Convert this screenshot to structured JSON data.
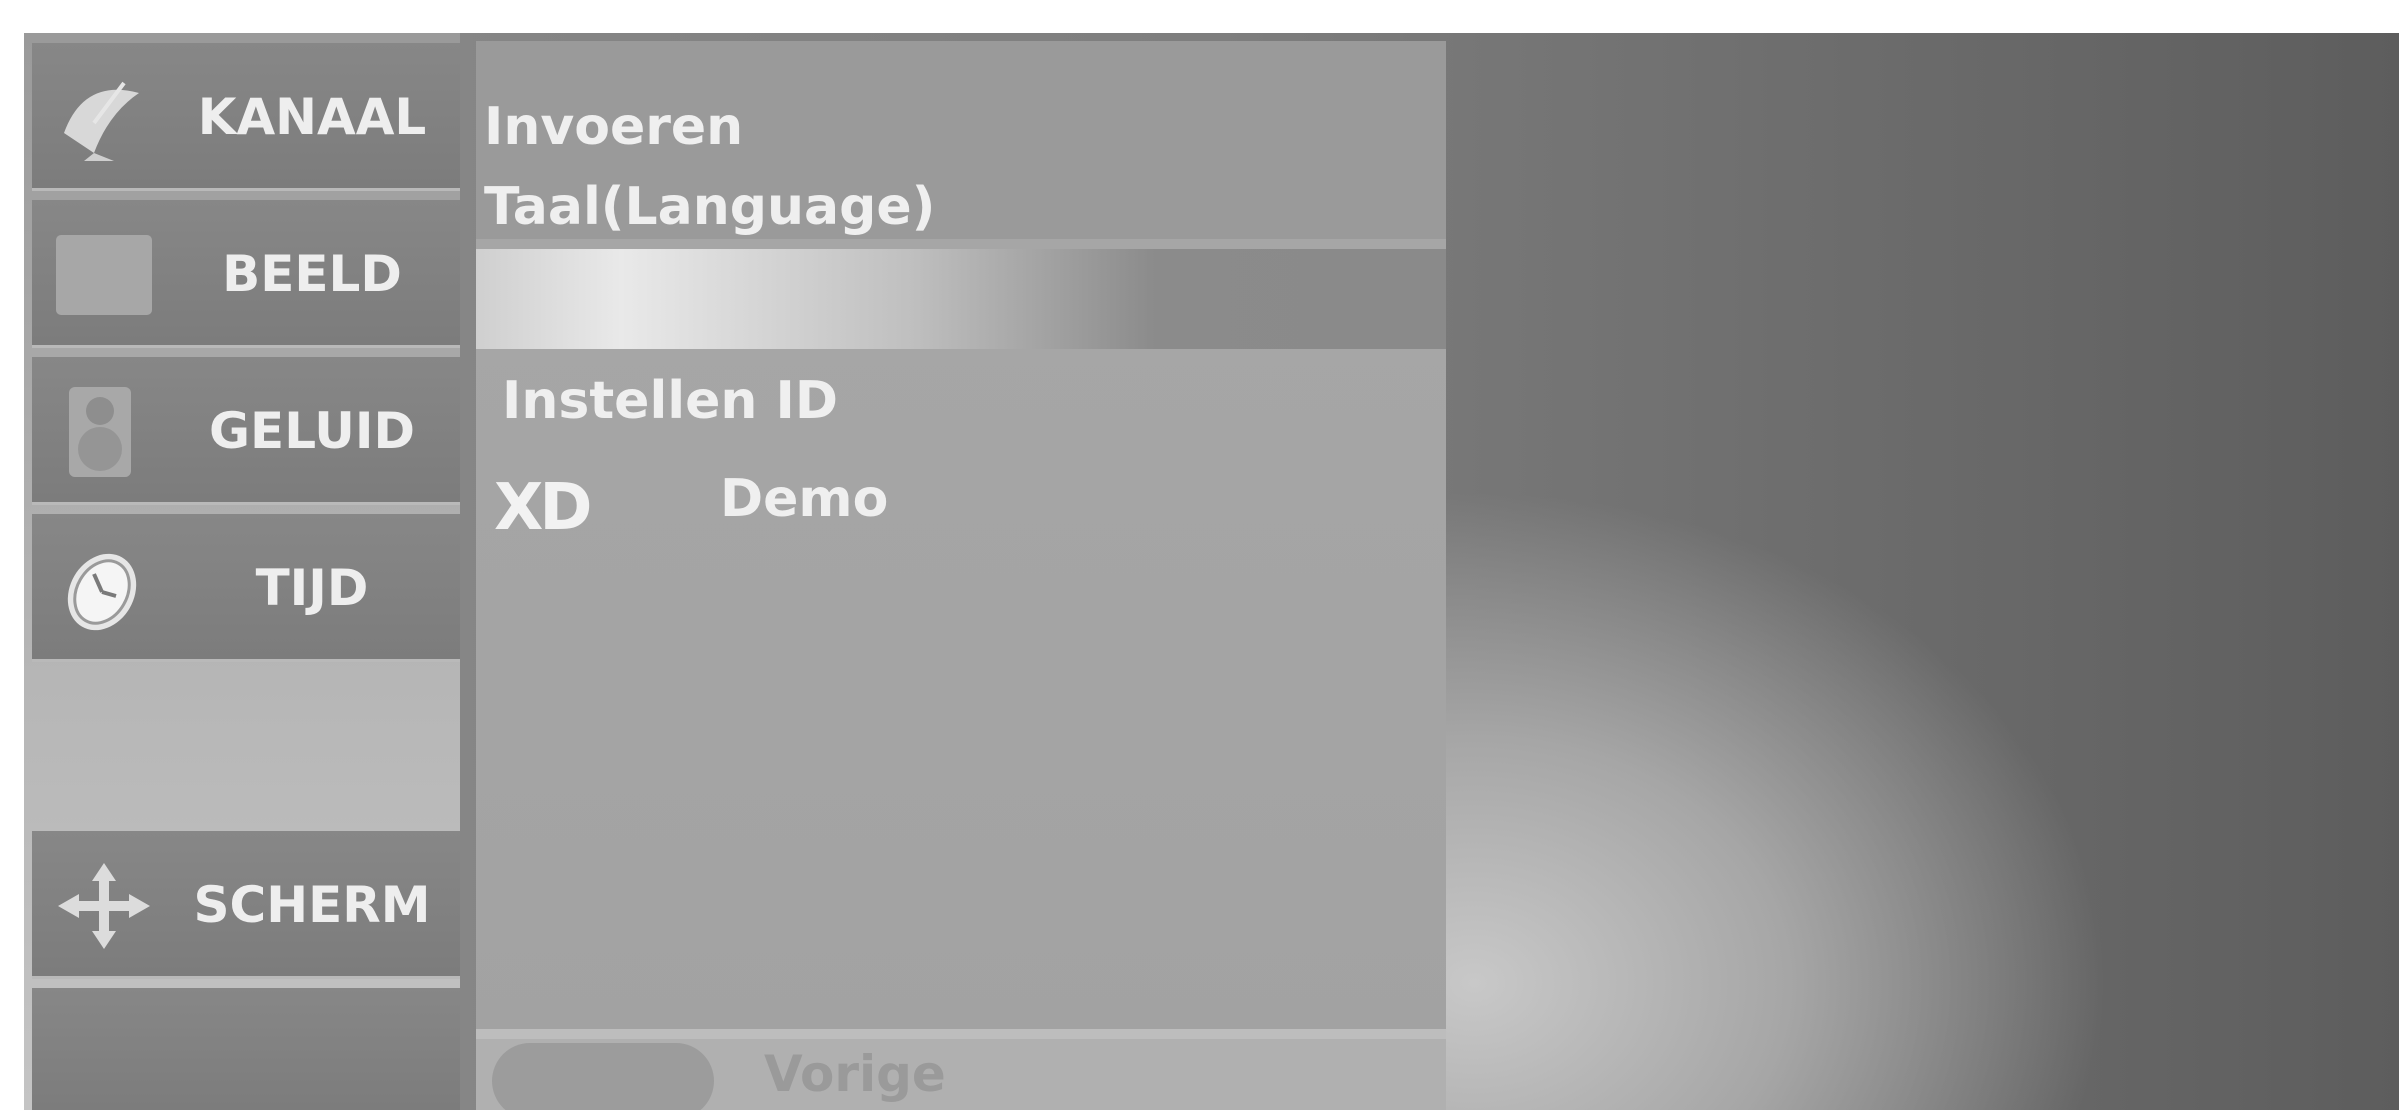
{
  "menu": {
    "items": [
      {
        "label": "KANAAL",
        "icon": "satellite-dish-icon"
      },
      {
        "label": "BEELD",
        "icon": "picture-square-icon"
      },
      {
        "label": "GELUID",
        "icon": "speaker-icon"
      },
      {
        "label": "TIJD",
        "icon": "clock-icon"
      },
      {
        "label": "SCHERM",
        "icon": "move-arrows-icon"
      }
    ]
  },
  "submenu": {
    "items": [
      "Invoeren",
      "Taal(Language)",
      "Instellen ID",
      "Demo"
    ],
    "xd_logo_text": "XD"
  },
  "footer": {
    "prev_label": "Vorige"
  }
}
